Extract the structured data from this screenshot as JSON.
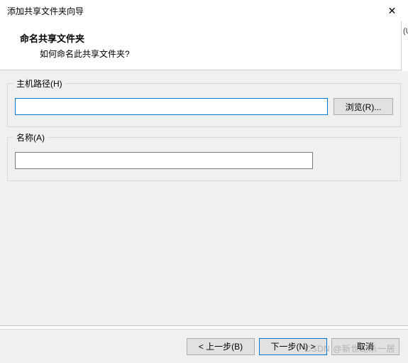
{
  "titlebar": {
    "title": "添加共享文件夹向导",
    "close_glyph": "✕"
  },
  "header": {
    "heading": "命名共享文件夹",
    "subheading": "如何命名此共享文件夹?"
  },
  "fields": {
    "host": {
      "label": "主机路径(H)",
      "value": "",
      "browse_label": "浏览(R)..."
    },
    "name": {
      "label": "名称(A)",
      "value": ""
    }
  },
  "footer": {
    "back": "< 上一步(B)",
    "next": "下一步(N) >",
    "cancel": "取消"
  },
  "watermark": "CSDN @新世纪杀一居",
  "side_fragment": "(U"
}
